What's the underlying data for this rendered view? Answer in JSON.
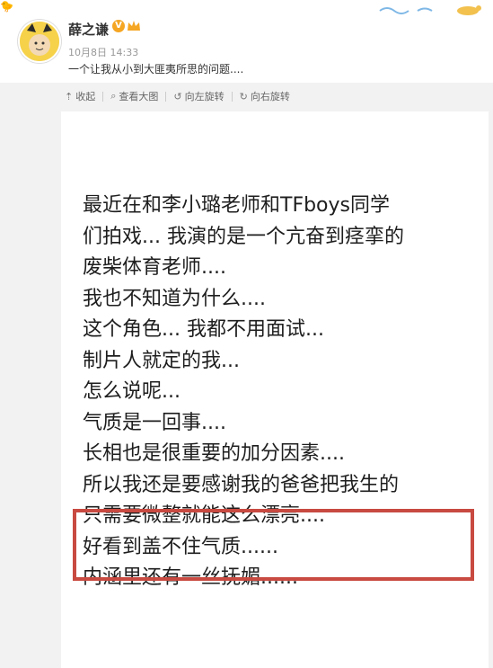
{
  "post": {
    "username": "薛之谦",
    "verified_badge": "V",
    "timestamp": "10月8日 14:33",
    "snippet": "一个让我从小到大匪夷所思的问题...."
  },
  "toolbar": {
    "collapse_label": "收起",
    "view_large_label": "查看大图",
    "rotate_left_label": "向左旋转",
    "rotate_right_label": "向右旋转"
  },
  "icons": {
    "collapse": "up-arrow-icon",
    "view_large": "magnifier-icon",
    "rotate_left": "rotate-left-icon",
    "rotate_right": "rotate-right-icon"
  },
  "image_text": {
    "lines": [
      "最近在和李小璐老师和TFboys同学",
      "们拍戏... 我演的是一个亢奋到痉挛的",
      "废柴体育老师....",
      "我也不知道为什么....",
      "这个角色... 我都不用面试...",
      "制片人就定的我...",
      "怎么说呢...",
      "气质是一回事....",
      "长相也是很重要的加分因素....",
      "所以我还是要感谢我的爸爸把我生的",
      "只需要微整就能这么漂亮....",
      "好看到盖不住气质......",
      "内涵里还有一丝抚媚......"
    ]
  },
  "colors": {
    "highlight_border": "#c84a41",
    "badge": "#f5a623",
    "avatar": "#f6d24a"
  }
}
